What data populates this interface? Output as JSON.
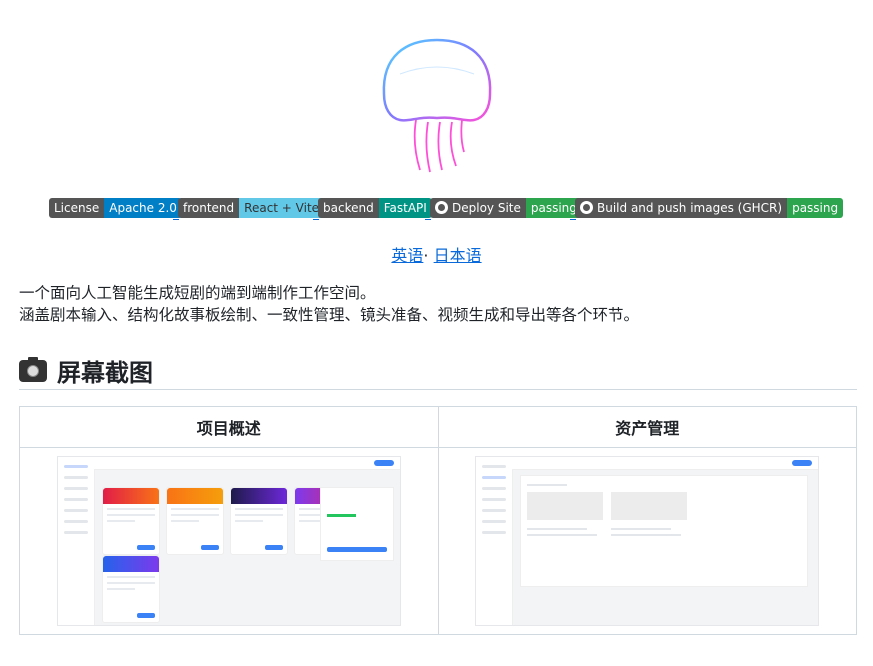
{
  "logo": {
    "name": "jellyfish-logo"
  },
  "badges": [
    {
      "label": "License",
      "value": "Apache 2.0",
      "color": "#007ec6",
      "icon": ""
    },
    {
      "label": "frontend",
      "value": "React + Vite",
      "color": "#61c8e8",
      "icon": ""
    },
    {
      "label": "backend",
      "value": "FastAPI",
      "color": "#009485",
      "icon": ""
    },
    {
      "label": "Deploy Site",
      "value": "passing",
      "color": "#2da44e",
      "icon": "github-icon"
    },
    {
      "label": "Build and push images (GHCR)",
      "value": "passing",
      "color": "#2da44e",
      "icon": "github-icon"
    }
  ],
  "languages": {
    "en": "英语",
    "sep": "·",
    "ja": "日本语"
  },
  "description": [
    "一个面向人工智能生成短剧的端到端制作工作空间。",
    "涵盖剧本输入、结构化故事板绘制、一致性管理、镜头准备、视频生成和导出等各个环节。"
  ],
  "sections": {
    "screenshots": {
      "icon": "camera-icon",
      "title": "屏幕截图"
    }
  },
  "screenshot_table": {
    "headers": [
      "项目概述",
      "资产管理"
    ]
  }
}
